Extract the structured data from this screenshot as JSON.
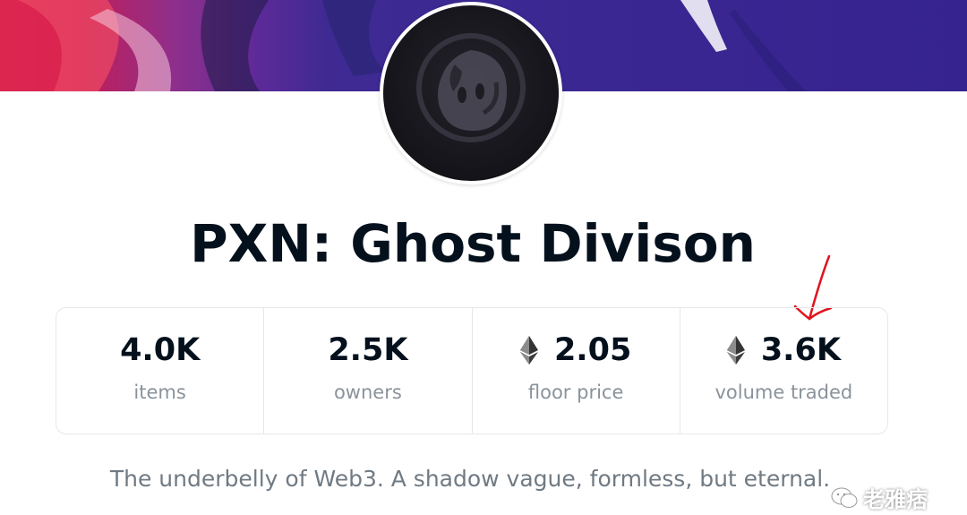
{
  "collection": {
    "title": "PXN: Ghost Divison",
    "description": "The underbelly of Web3. A shadow vague, formless, but eternal."
  },
  "stats": [
    {
      "value": "4.0K",
      "label": "items",
      "eth": false
    },
    {
      "value": "2.5K",
      "label": "owners",
      "eth": false
    },
    {
      "value": "2.05",
      "label": "floor price",
      "eth": true
    },
    {
      "value": "3.6K",
      "label": "volume traded",
      "eth": true
    }
  ],
  "icons": {
    "currency": "ethereum-icon",
    "avatar": "ghost-logo-icon",
    "annotation": "red-arrow-annotation",
    "watermark": "wechat-icon"
  },
  "colors": {
    "title": "#04111d",
    "label": "#8a939b",
    "description": "#707a83",
    "annotation": "#e0141e"
  },
  "watermark": {
    "text": "老雅痞"
  }
}
